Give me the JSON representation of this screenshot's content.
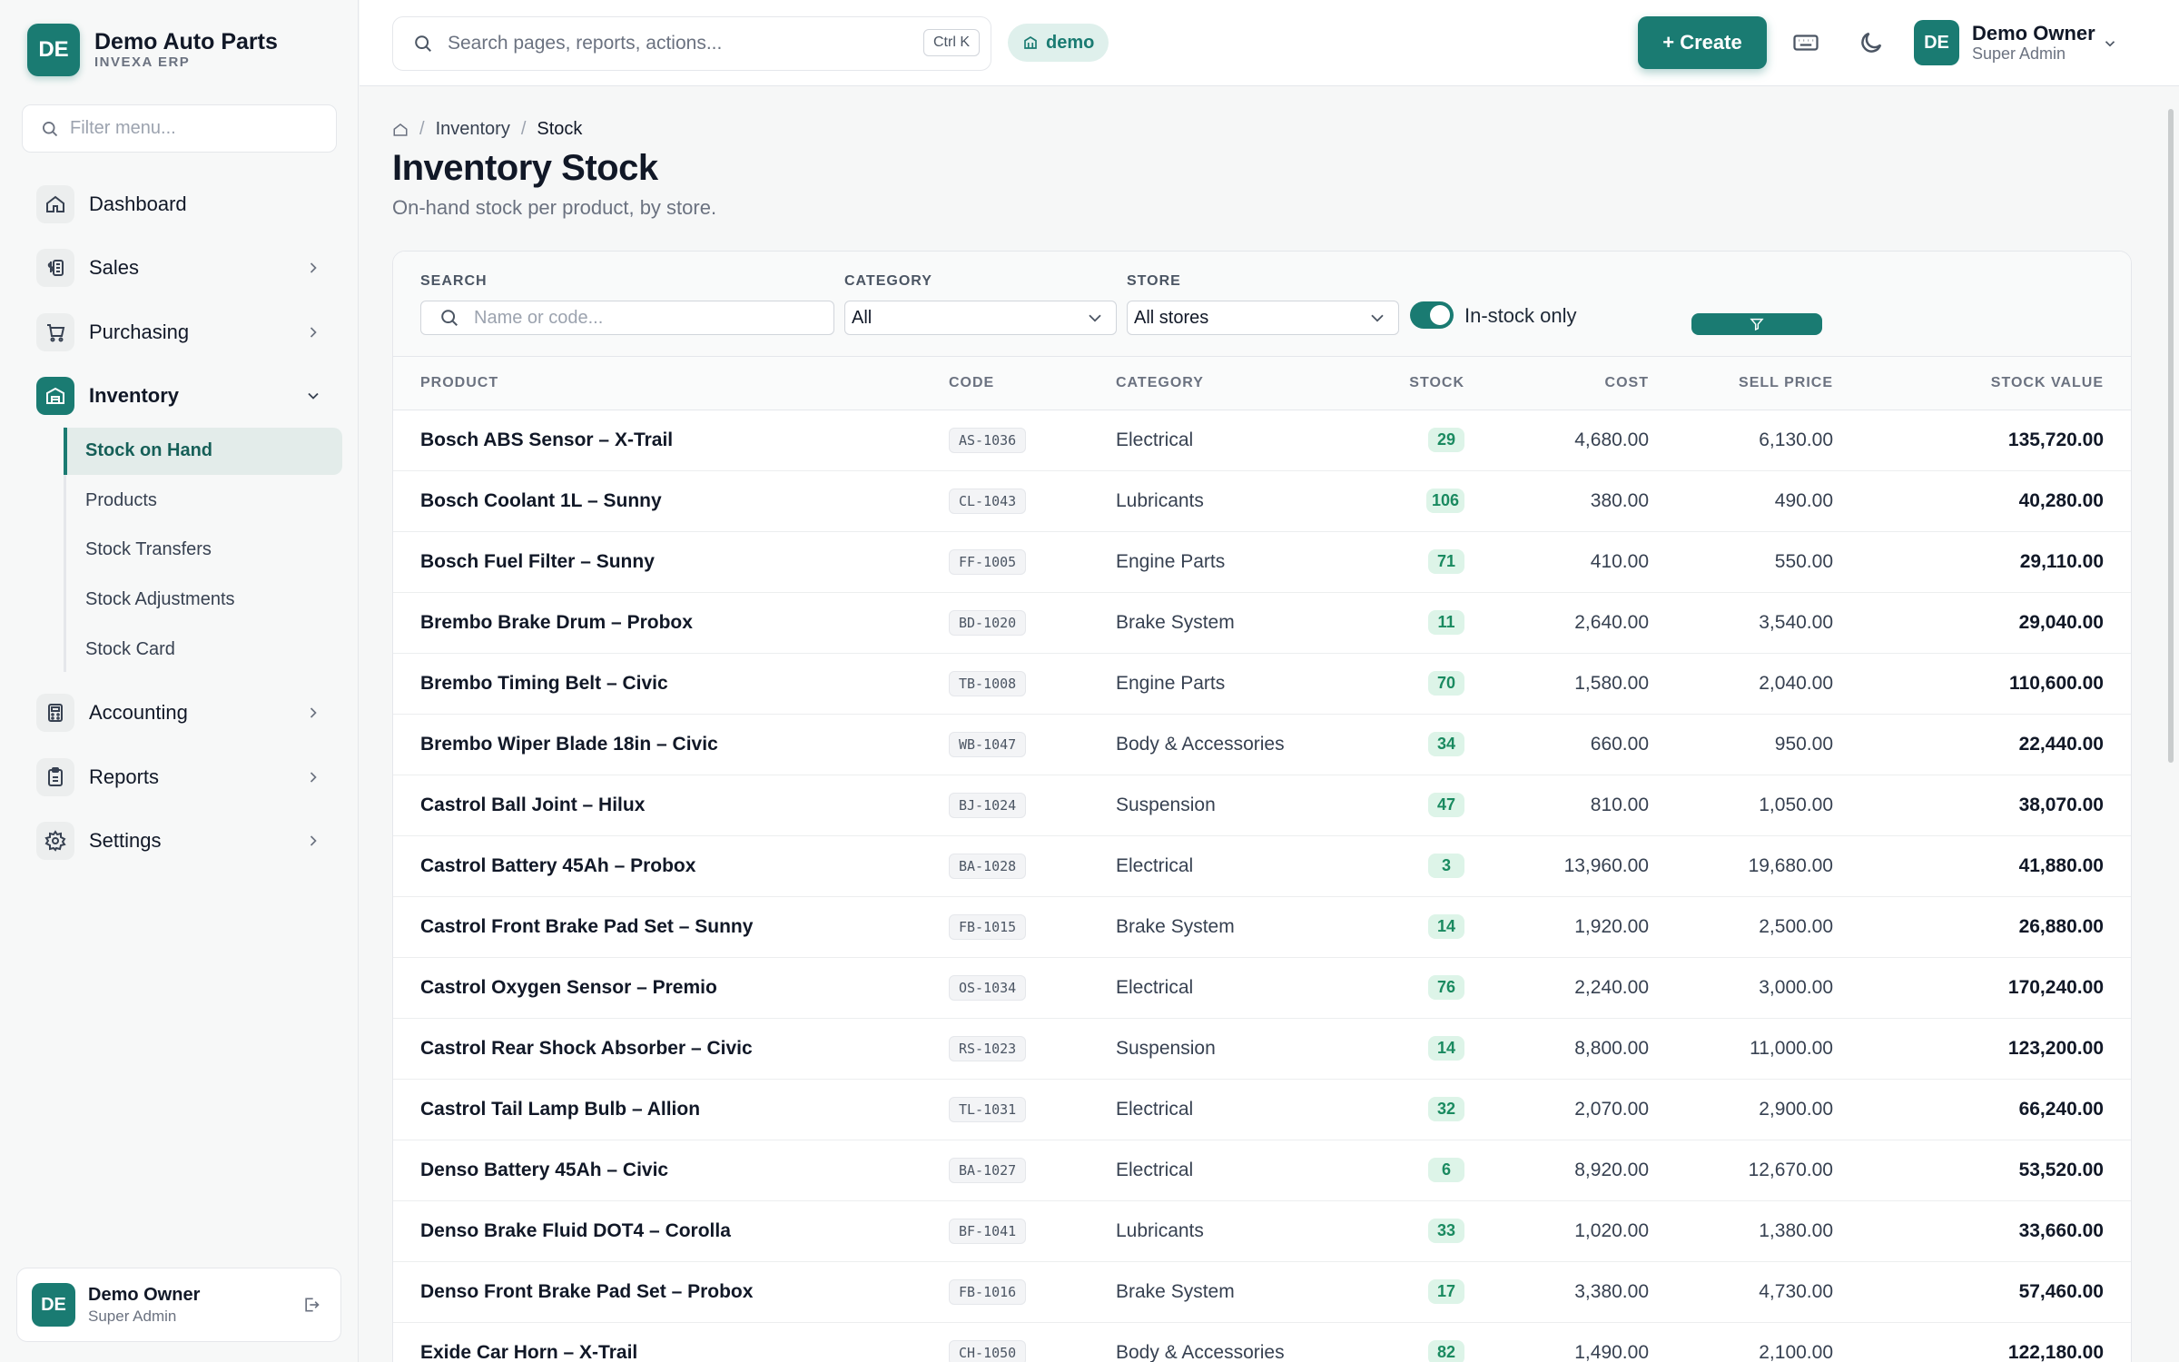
{
  "brand": {
    "initials": "DE",
    "name": "Demo Auto Parts",
    "sub": "INVEXA ERP"
  },
  "sidebar": {
    "filter_placeholder": "Filter menu...",
    "items": [
      {
        "label": "Dashboard",
        "icon": "home-icon"
      },
      {
        "label": "Sales",
        "icon": "money-icon"
      },
      {
        "label": "Purchasing",
        "icon": "cart-icon"
      },
      {
        "label": "Inventory",
        "icon": "warehouse-icon"
      },
      {
        "label": "Accounting",
        "icon": "calculator-icon"
      },
      {
        "label": "Reports",
        "icon": "report-icon"
      },
      {
        "label": "Settings",
        "icon": "gear-icon"
      }
    ],
    "inventory_sub": [
      "Stock on Hand",
      "Products",
      "Stock Transfers",
      "Stock Adjustments",
      "Stock Card"
    ],
    "user": {
      "initials": "DE",
      "name": "Demo Owner",
      "role": "Super Admin"
    }
  },
  "header": {
    "search_placeholder": "Search pages, reports, actions...",
    "shortcut": "Ctrl K",
    "tenant": "demo",
    "create_label": "+ Create",
    "user": {
      "initials": "DE",
      "name": "Demo Owner",
      "role": "Super Admin"
    }
  },
  "breadcrumb": [
    "Inventory",
    "Stock"
  ],
  "page": {
    "title": "Inventory Stock",
    "subtitle": "On-hand stock per product, by store."
  },
  "filters": {
    "search_label": "SEARCH",
    "search_placeholder": "Name or code...",
    "category_label": "CATEGORY",
    "category_value": "All",
    "store_label": "STORE",
    "store_value": "All stores",
    "instock_label": "In-stock only",
    "instock_on": true
  },
  "table": {
    "headers": [
      "PRODUCT",
      "CODE",
      "CATEGORY",
      "STOCK",
      "COST",
      "SELL PRICE",
      "STOCK VALUE"
    ],
    "rows": [
      [
        "Bosch ABS Sensor – X-Trail",
        "AS-1036",
        "Electrical",
        "29",
        "4,680.00",
        "6,130.00",
        "135,720.00"
      ],
      [
        "Bosch Coolant 1L – Sunny",
        "CL-1043",
        "Lubricants",
        "106",
        "380.00",
        "490.00",
        "40,280.00"
      ],
      [
        "Bosch Fuel Filter – Sunny",
        "FF-1005",
        "Engine Parts",
        "71",
        "410.00",
        "550.00",
        "29,110.00"
      ],
      [
        "Brembo Brake Drum – Probox",
        "BD-1020",
        "Brake System",
        "11",
        "2,640.00",
        "3,540.00",
        "29,040.00"
      ],
      [
        "Brembo Timing Belt – Civic",
        "TB-1008",
        "Engine Parts",
        "70",
        "1,580.00",
        "2,040.00",
        "110,600.00"
      ],
      [
        "Brembo Wiper Blade 18in – Civic",
        "WB-1047",
        "Body & Accessories",
        "34",
        "660.00",
        "950.00",
        "22,440.00"
      ],
      [
        "Castrol Ball Joint – Hilux",
        "BJ-1024",
        "Suspension",
        "47",
        "810.00",
        "1,050.00",
        "38,070.00"
      ],
      [
        "Castrol Battery 45Ah – Probox",
        "BA-1028",
        "Electrical",
        "3",
        "13,960.00",
        "19,680.00",
        "41,880.00"
      ],
      [
        "Castrol Front Brake Pad Set – Sunny",
        "FB-1015",
        "Brake System",
        "14",
        "1,920.00",
        "2,500.00",
        "26,880.00"
      ],
      [
        "Castrol Oxygen Sensor – Premio",
        "OS-1034",
        "Electrical",
        "76",
        "2,240.00",
        "3,000.00",
        "170,240.00"
      ],
      [
        "Castrol Rear Shock Absorber – Civic",
        "RS-1023",
        "Suspension",
        "14",
        "8,800.00",
        "11,000.00",
        "123,200.00"
      ],
      [
        "Castrol Tail Lamp Bulb – Allion",
        "TL-1031",
        "Electrical",
        "32",
        "2,070.00",
        "2,900.00",
        "66,240.00"
      ],
      [
        "Denso Battery 45Ah – Civic",
        "BA-1027",
        "Electrical",
        "6",
        "8,920.00",
        "12,670.00",
        "53,520.00"
      ],
      [
        "Denso Brake Fluid DOT4 – Corolla",
        "BF-1041",
        "Lubricants",
        "33",
        "1,020.00",
        "1,380.00",
        "33,660.00"
      ],
      [
        "Denso Front Brake Pad Set – Probox",
        "FB-1016",
        "Brake System",
        "17",
        "3,380.00",
        "4,730.00",
        "57,460.00"
      ],
      [
        "Exide Car Horn – X-Trail",
        "CH-1050",
        "Body & Accessories",
        "82",
        "1,490.00",
        "2,100.00",
        "122,180.00"
      ]
    ]
  },
  "colors": {
    "accent": "#1a7b72",
    "stock_badge_bg": "#ddf4e8",
    "stock_badge_text": "#1a8a60"
  }
}
